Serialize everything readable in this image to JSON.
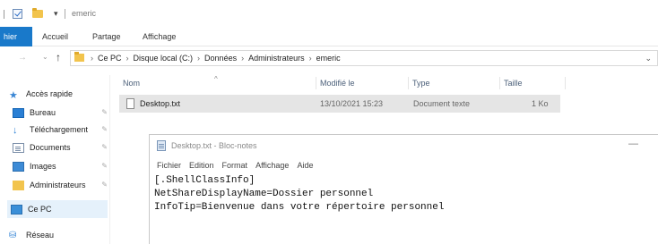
{
  "titlebar": {
    "dropdown_glyph": "▾",
    "window_title": "emeric"
  },
  "ribbon": {
    "tabs": [
      "hier",
      "Accueil",
      "Partage",
      "Affichage"
    ]
  },
  "address": {
    "crumbs": [
      "Ce PC",
      "Disque local (C:)",
      "Données",
      "Administrateurs",
      "emeric"
    ],
    "separator": "›"
  },
  "sidebar": {
    "items": [
      {
        "label": "Accès rapide",
        "icon": "star-icon",
        "pinned": false
      },
      {
        "label": "Bureau",
        "icon": "desktop-icon",
        "pinned": true
      },
      {
        "label": "Téléchargement",
        "icon": "download-icon",
        "pinned": true
      },
      {
        "label": "Documents",
        "icon": "documents-icon",
        "pinned": true
      },
      {
        "label": "Images",
        "icon": "images-icon",
        "pinned": true
      },
      {
        "label": "Administrateurs",
        "icon": "folder-icon",
        "pinned": true
      },
      {
        "label": "Ce PC",
        "icon": "pc-icon",
        "pinned": false
      },
      {
        "label": "Réseau",
        "icon": "network-icon",
        "pinned": false
      }
    ]
  },
  "filelist": {
    "columns": {
      "name": "Nom",
      "modified": "Modifié le",
      "type": "Type",
      "size": "Taille"
    },
    "rows": [
      {
        "name": "Desktop.txt",
        "modified": "13/10/2021 15:23",
        "type": "Document texte",
        "size": "1 Ko"
      }
    ]
  },
  "notepad": {
    "title": "Desktop.txt - Bloc-notes",
    "menu": [
      "Fichier",
      "Edition",
      "Format",
      "Affichage",
      "Aide"
    ],
    "lines": [
      "[.ShellClassInfo]",
      "NetShareDisplayName=Dossier personnel",
      "InfoTip=Bienvenue dans votre répertoire personnel"
    ]
  },
  "colors": {
    "file_tab": "#1979ca",
    "selected_row": "#e5e5e5",
    "sidebar_selected": "#e5f1fb"
  }
}
